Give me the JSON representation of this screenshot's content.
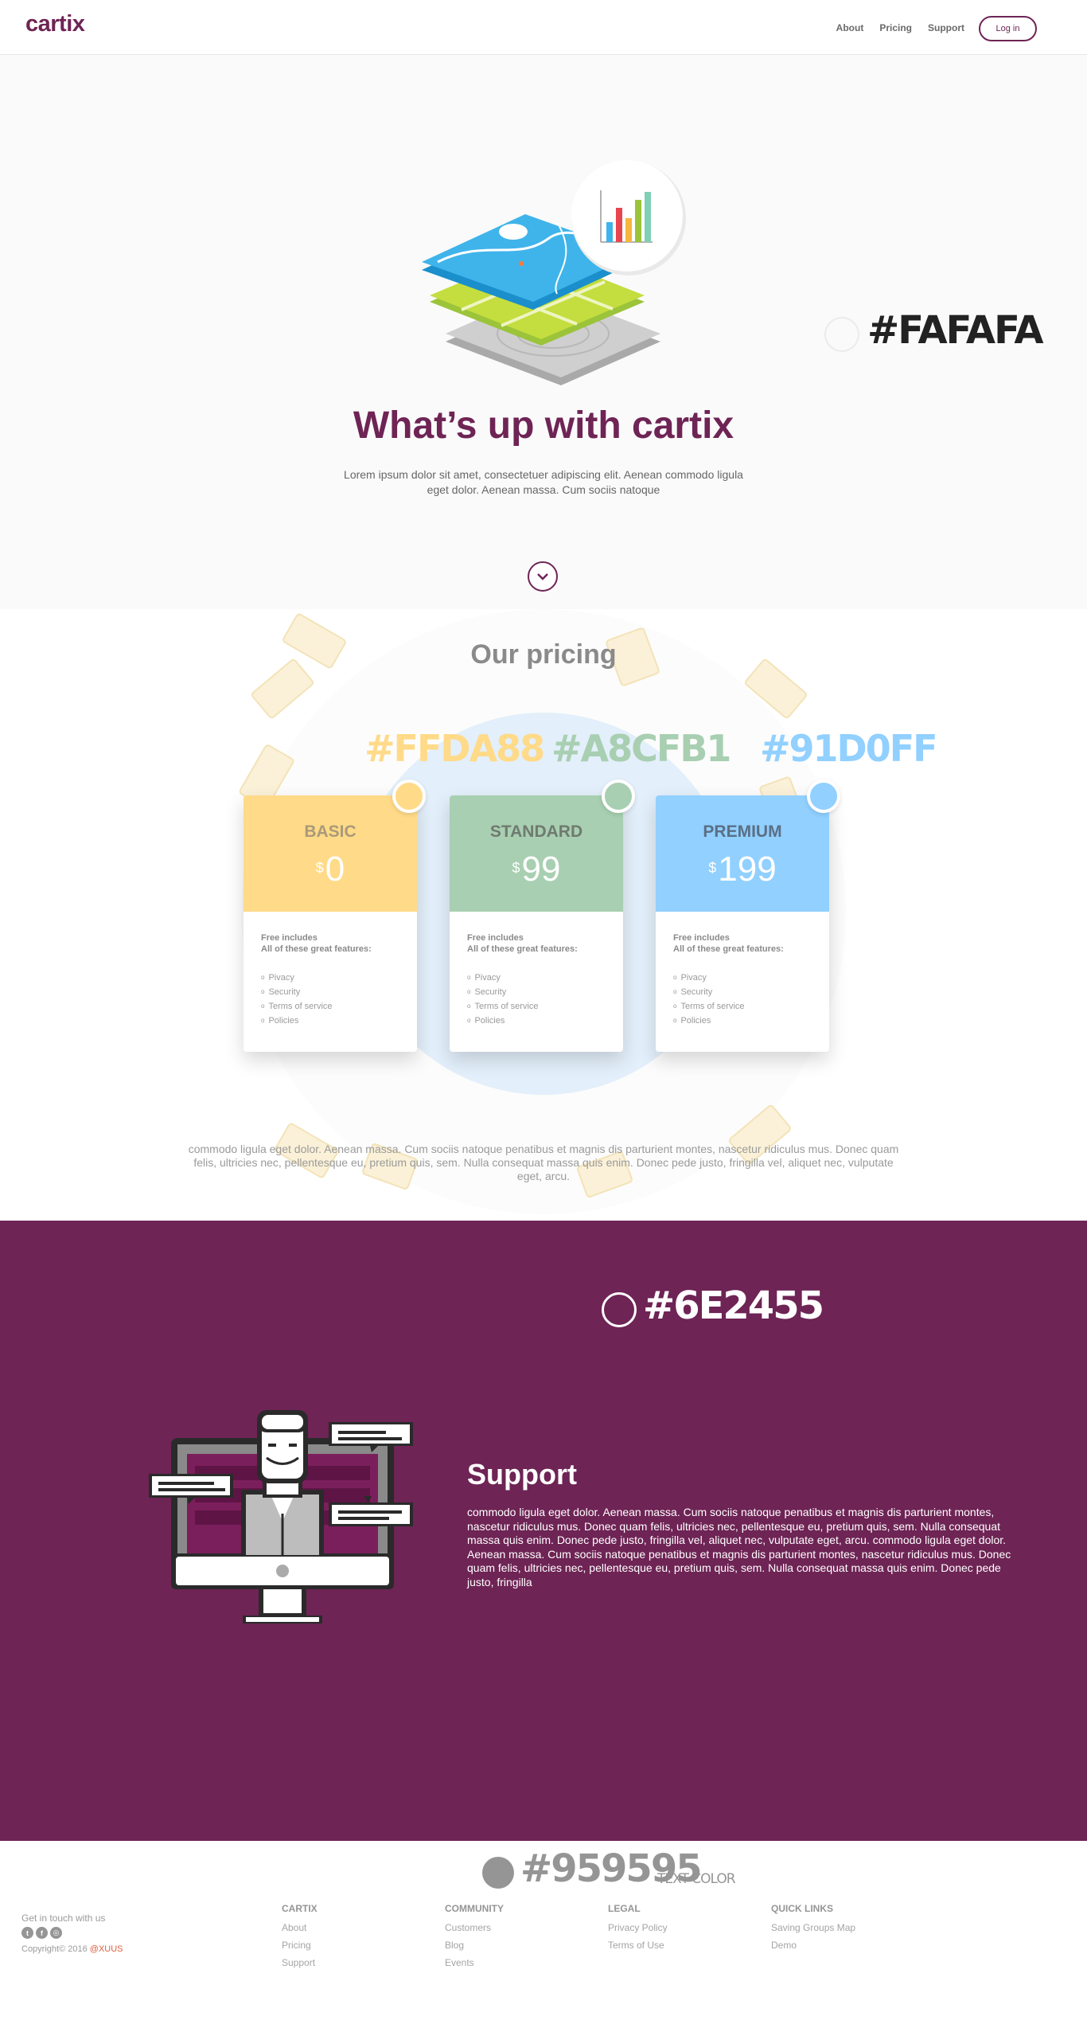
{
  "nav": {
    "logo": "cartix",
    "links": [
      "About",
      "Pricing",
      "Support"
    ],
    "login": "Log in"
  },
  "hero": {
    "title": "What’s up with cartix",
    "text": "Lorem ipsum dolor sit amet, consectetuer adipiscing elit. Aenean commodo ligula eget dolor. Aenean massa. Cum sociis natoque",
    "swatch": "#FAFAFA"
  },
  "pricing": {
    "title": "Our pricing",
    "swatches": [
      "#FFDA88",
      "#A8CFB1",
      "#91D0FF"
    ],
    "plans": [
      {
        "name": "BASIC",
        "currency": "$",
        "price": "0",
        "color": "#FFDA88",
        "name_color": "#a99a7a",
        "features_head_1": "Free includes",
        "features_head_2": "All of these great features:",
        "features": [
          "Pivacy",
          "Security",
          "Terms of service",
          "Policies"
        ]
      },
      {
        "name": "STANDARD",
        "currency": "$",
        "price": "99",
        "color": "#A8CFB1",
        "name_color": "#6f7a70",
        "features_head_1": "Free includes",
        "features_head_2": "All of these great features:",
        "features": [
          "Pivacy",
          "Security",
          "Terms of service",
          "Policies"
        ]
      },
      {
        "name": "PREMIUM",
        "currency": "$",
        "price": "199",
        "color": "#91D0FF",
        "name_color": "#5a6f86",
        "features_head_1": "Free includes",
        "features_head_2": "All of these great features:",
        "features": [
          "Pivacy",
          "Security",
          "Terms of service",
          "Policies"
        ]
      }
    ],
    "text": "commodo ligula eget dolor. Aenean massa. Cum sociis natoque penatibus et magnis dis parturient montes, nascetur ridiculus mus. Donec quam felis, ultricies nec, pellentesque eu, pretium quis, sem. Nulla consequat massa quis enim. Donec pede justo, fringilla vel, aliquet nec, vulputate eget, arcu."
  },
  "support": {
    "swatch": "#6E2455",
    "title": "Support",
    "text": "commodo ligula eget dolor. Aenean massa. Cum sociis natoque penatibus et magnis dis parturient montes, nascetur ridiculus mus. Donec quam felis, ultricies nec, pellentesque eu, pretium quis, sem. Nulla consequat massa quis enim. Donec pede justo, fringilla vel, aliquet nec, vulputate eget, arcu. commodo ligula eget dolor. Aenean massa. Cum sociis natoque penatibus et magnis dis parturient montes, nascetur ridiculus mus. Donec quam felis, ultricies nec, pellentesque eu, pretium quis, sem. Nulla consequat massa quis enim. Donec pede justo, fringilla"
  },
  "footer": {
    "text_color_swatch": "#959595",
    "text_color_label": "TEXT COLOR",
    "touch": "Get in touch with us",
    "social_icons": [
      "twitter-icon",
      "facebook-icon",
      "dribbble-icon"
    ],
    "copyright": "Copyright© 2016",
    "copyright_brand": "@XUUS",
    "columns": [
      {
        "title": "CARTIX",
        "links": [
          "About",
          "Pricing",
          "Support"
        ]
      },
      {
        "title": "COMMUNITY",
        "links": [
          "Customers",
          "Blog",
          "Events"
        ]
      },
      {
        "title": "LEGAL",
        "links": [
          "Privacy Policy",
          "Terms of Use"
        ]
      },
      {
        "title": "QUICK LINKS",
        "links": [
          "Saving Groups Map",
          "Demo"
        ]
      }
    ]
  }
}
